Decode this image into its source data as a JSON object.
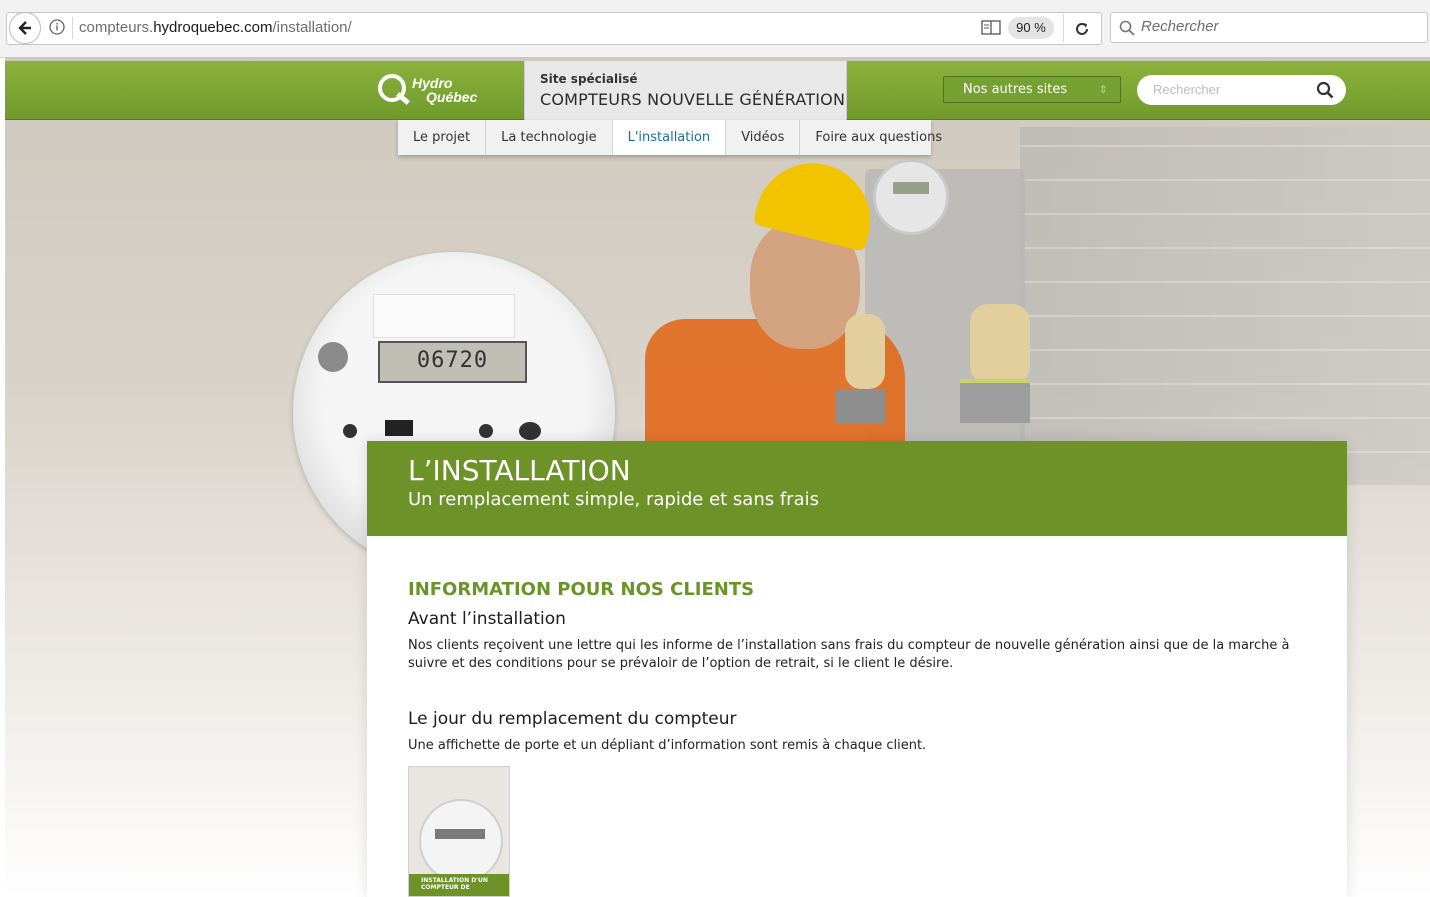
{
  "browser": {
    "url_prefix": "compteurs.",
    "url_domain": "hydroquebec.com",
    "url_path": "/installation/",
    "zoom": "90 %",
    "search_placeholder": "Rechercher"
  },
  "header": {
    "logo_line1": "Hydro",
    "logo_line2": "Québec",
    "site_label": "Site spécialisé",
    "site_name": "COMPTEURS NOUVELLE GÉNÉRATION",
    "other_sites": "Nos autres sites",
    "search_placeholder": "Rechercher"
  },
  "nav": {
    "items": [
      {
        "label": "Le projet"
      },
      {
        "label": "La technologie"
      },
      {
        "label": "L'installation"
      },
      {
        "label": "Vidéos"
      },
      {
        "label": "Foire aux questions"
      }
    ],
    "active_index": 2
  },
  "hero": {
    "meter_display": "06720"
  },
  "content": {
    "title": "L’INSTALLATION",
    "subtitle": "Un remplacement simple, rapide et sans frais",
    "section_title": "INFORMATION POUR NOS CLIENTS",
    "before_title": "Avant l’installation",
    "before_text": "Nos clients reçoivent une lettre qui les informe de l’installation sans frais du compteur de nouvelle génération ainsi que de la marche à suivre et des conditions pour se prévaloir de l’option de retrait, si le client le désire.",
    "day_title": "Le jour du remplacement du compteur",
    "day_text": "Une affichette de porte et un dépliant d’information sont remis à chaque client.",
    "flyer_caption": "INSTALLATION D'UN COMPTEUR DE"
  },
  "colors": {
    "brand_green": "#6c9228",
    "active_nav": "#1b6f9c"
  }
}
